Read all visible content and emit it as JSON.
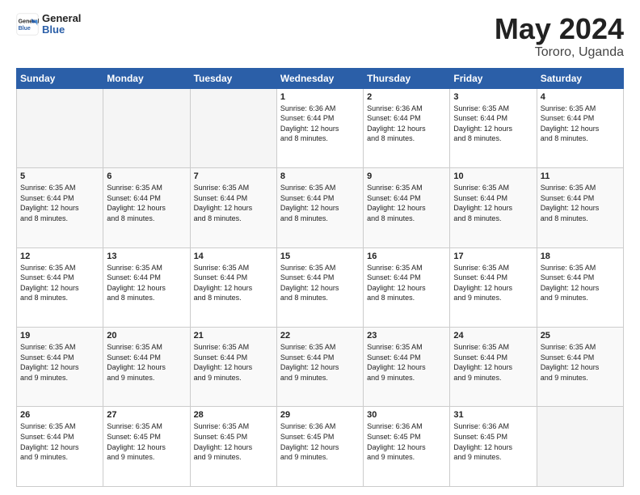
{
  "logo": {
    "line1": "General",
    "line2": "Blue"
  },
  "title": {
    "month_year": "May 2024",
    "location": "Tororo, Uganda"
  },
  "weekdays": [
    "Sunday",
    "Monday",
    "Tuesday",
    "Wednesday",
    "Thursday",
    "Friday",
    "Saturday"
  ],
  "weeks": [
    [
      {
        "day": "",
        "info": ""
      },
      {
        "day": "",
        "info": ""
      },
      {
        "day": "",
        "info": ""
      },
      {
        "day": "1",
        "info": "Sunrise: 6:36 AM\nSunset: 6:44 PM\nDaylight: 12 hours\nand 8 minutes."
      },
      {
        "day": "2",
        "info": "Sunrise: 6:36 AM\nSunset: 6:44 PM\nDaylight: 12 hours\nand 8 minutes."
      },
      {
        "day": "3",
        "info": "Sunrise: 6:35 AM\nSunset: 6:44 PM\nDaylight: 12 hours\nand 8 minutes."
      },
      {
        "day": "4",
        "info": "Sunrise: 6:35 AM\nSunset: 6:44 PM\nDaylight: 12 hours\nand 8 minutes."
      }
    ],
    [
      {
        "day": "5",
        "info": "Sunrise: 6:35 AM\nSunset: 6:44 PM\nDaylight: 12 hours\nand 8 minutes."
      },
      {
        "day": "6",
        "info": "Sunrise: 6:35 AM\nSunset: 6:44 PM\nDaylight: 12 hours\nand 8 minutes."
      },
      {
        "day": "7",
        "info": "Sunrise: 6:35 AM\nSunset: 6:44 PM\nDaylight: 12 hours\nand 8 minutes."
      },
      {
        "day": "8",
        "info": "Sunrise: 6:35 AM\nSunset: 6:44 PM\nDaylight: 12 hours\nand 8 minutes."
      },
      {
        "day": "9",
        "info": "Sunrise: 6:35 AM\nSunset: 6:44 PM\nDaylight: 12 hours\nand 8 minutes."
      },
      {
        "day": "10",
        "info": "Sunrise: 6:35 AM\nSunset: 6:44 PM\nDaylight: 12 hours\nand 8 minutes."
      },
      {
        "day": "11",
        "info": "Sunrise: 6:35 AM\nSunset: 6:44 PM\nDaylight: 12 hours\nand 8 minutes."
      }
    ],
    [
      {
        "day": "12",
        "info": "Sunrise: 6:35 AM\nSunset: 6:44 PM\nDaylight: 12 hours\nand 8 minutes."
      },
      {
        "day": "13",
        "info": "Sunrise: 6:35 AM\nSunset: 6:44 PM\nDaylight: 12 hours\nand 8 minutes."
      },
      {
        "day": "14",
        "info": "Sunrise: 6:35 AM\nSunset: 6:44 PM\nDaylight: 12 hours\nand 8 minutes."
      },
      {
        "day": "15",
        "info": "Sunrise: 6:35 AM\nSunset: 6:44 PM\nDaylight: 12 hours\nand 8 minutes."
      },
      {
        "day": "16",
        "info": "Sunrise: 6:35 AM\nSunset: 6:44 PM\nDaylight: 12 hours\nand 8 minutes."
      },
      {
        "day": "17",
        "info": "Sunrise: 6:35 AM\nSunset: 6:44 PM\nDaylight: 12 hours\nand 9 minutes."
      },
      {
        "day": "18",
        "info": "Sunrise: 6:35 AM\nSunset: 6:44 PM\nDaylight: 12 hours\nand 9 minutes."
      }
    ],
    [
      {
        "day": "19",
        "info": "Sunrise: 6:35 AM\nSunset: 6:44 PM\nDaylight: 12 hours\nand 9 minutes."
      },
      {
        "day": "20",
        "info": "Sunrise: 6:35 AM\nSunset: 6:44 PM\nDaylight: 12 hours\nand 9 minutes."
      },
      {
        "day": "21",
        "info": "Sunrise: 6:35 AM\nSunset: 6:44 PM\nDaylight: 12 hours\nand 9 minutes."
      },
      {
        "day": "22",
        "info": "Sunrise: 6:35 AM\nSunset: 6:44 PM\nDaylight: 12 hours\nand 9 minutes."
      },
      {
        "day": "23",
        "info": "Sunrise: 6:35 AM\nSunset: 6:44 PM\nDaylight: 12 hours\nand 9 minutes."
      },
      {
        "day": "24",
        "info": "Sunrise: 6:35 AM\nSunset: 6:44 PM\nDaylight: 12 hours\nand 9 minutes."
      },
      {
        "day": "25",
        "info": "Sunrise: 6:35 AM\nSunset: 6:44 PM\nDaylight: 12 hours\nand 9 minutes."
      }
    ],
    [
      {
        "day": "26",
        "info": "Sunrise: 6:35 AM\nSunset: 6:44 PM\nDaylight: 12 hours\nand 9 minutes."
      },
      {
        "day": "27",
        "info": "Sunrise: 6:35 AM\nSunset: 6:45 PM\nDaylight: 12 hours\nand 9 minutes."
      },
      {
        "day": "28",
        "info": "Sunrise: 6:35 AM\nSunset: 6:45 PM\nDaylight: 12 hours\nand 9 minutes."
      },
      {
        "day": "29",
        "info": "Sunrise: 6:36 AM\nSunset: 6:45 PM\nDaylight: 12 hours\nand 9 minutes."
      },
      {
        "day": "30",
        "info": "Sunrise: 6:36 AM\nSunset: 6:45 PM\nDaylight: 12 hours\nand 9 minutes."
      },
      {
        "day": "31",
        "info": "Sunrise: 6:36 AM\nSunset: 6:45 PM\nDaylight: 12 hours\nand 9 minutes."
      },
      {
        "day": "",
        "info": ""
      }
    ]
  ]
}
